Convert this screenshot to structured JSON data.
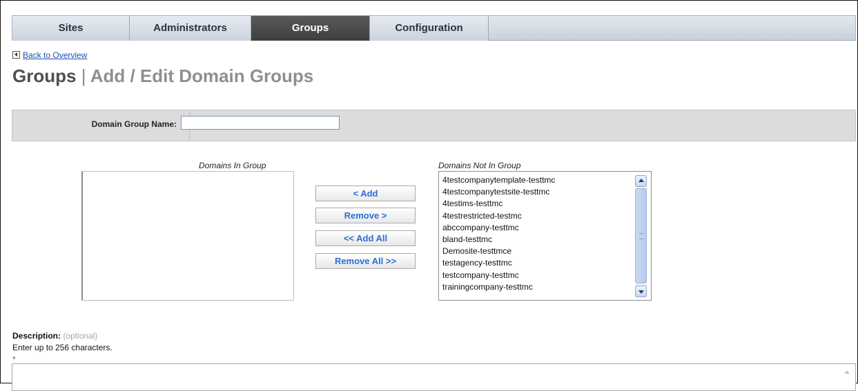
{
  "tabs": [
    {
      "label": "Sites"
    },
    {
      "label": "Administrators"
    },
    {
      "label": "Groups"
    },
    {
      "label": "Configuration"
    }
  ],
  "active_tab": "Groups",
  "back_link": "Back to Overview",
  "title": {
    "primary": "Groups",
    "separator": "|",
    "secondary": "Add / Edit Domain Groups"
  },
  "form": {
    "domain_group_name_label": "Domain Group Name:",
    "domain_group_name_value": ""
  },
  "lists": {
    "in_group_caption": "Domains In Group",
    "not_in_group_caption": "Domains Not In Group",
    "in_group": [],
    "not_in_group": [
      "4testcompanytemplate-testtmc",
      "4testcompanytestsite-testtmc",
      "4testims-testtmc",
      "4testrestricted-testmc",
      "abccompany-testtmc",
      "bland-testtmc",
      "Demosite-testtmce",
      "testagency-testtmc",
      "testcompany-testtmc",
      "trainingcompany-testtmc"
    ]
  },
  "buttons": {
    "add": "< Add",
    "remove": "Remove >",
    "add_all": "<< Add All",
    "remove_all": "Remove All >>"
  },
  "description": {
    "label": "Description:",
    "optional": "(optional)",
    "hint": "Enter up to 256 characters.",
    "required_marker": "*",
    "value": ""
  },
  "colors": {
    "active_tab": "#4a4a4a",
    "button_text": "#2a6ed6",
    "link": "#1a4fb5"
  }
}
